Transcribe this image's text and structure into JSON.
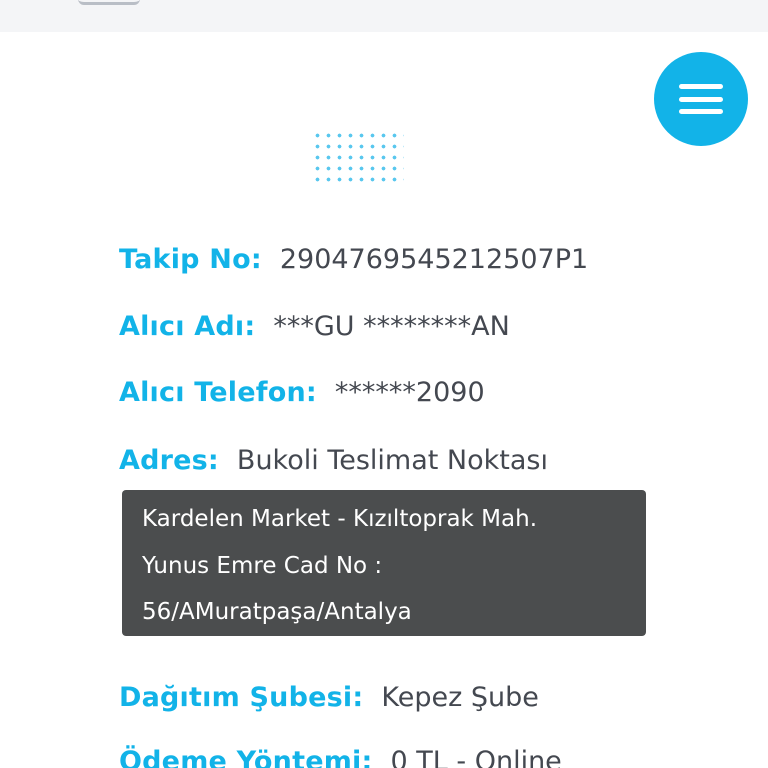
{
  "menu": {
    "icon": "hamburger-menu-icon",
    "accent": "#12b3e8"
  },
  "details": {
    "tracking_label": "Takip No:",
    "tracking_value": "2904769545212507P1",
    "recipient_label": "Alıcı Adı:",
    "recipient_value": "***GU ********AN",
    "phone_label": "Alıcı Telefon:",
    "phone_value": "******2090",
    "address_label": "Adres:",
    "address_value": "Bukoli Teslimat Noktası",
    "address_lines": [
      "Kardelen Market - Kızıltoprak Mah.",
      "Yunus Emre Cad No :",
      "56/AMuratpaşa/Antalya"
    ],
    "branch_label": "Dağıtım Şubesi:",
    "branch_value": "Kepez Şube",
    "payment_label": "Ödeme Yöntemi:",
    "payment_value": "0 TL - Online"
  },
  "colors": {
    "label": "#12b3e8",
    "value": "#444850",
    "address_box": "#4b4d4e"
  }
}
